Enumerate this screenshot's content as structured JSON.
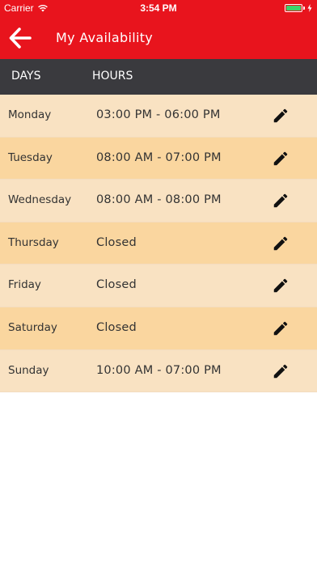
{
  "status_bar": {
    "carrier": "Carrier",
    "time": "3:54 PM"
  },
  "app_bar": {
    "title": "My Availability",
    "back_icon": "arrow-left-icon"
  },
  "table_header": {
    "days": "DAYS",
    "hours": "HOURS"
  },
  "availability": [
    {
      "day": "Monday",
      "hours": "03:00 PM - 06:00 PM"
    },
    {
      "day": "Tuesday",
      "hours": "08:00 AM - 07:00 PM"
    },
    {
      "day": "Wednesday",
      "hours": "08:00 AM - 08:00 PM"
    },
    {
      "day": "Thursday",
      "hours": "Closed"
    },
    {
      "day": "Friday",
      "hours": "Closed"
    },
    {
      "day": "Saturday",
      "hours": "Closed"
    },
    {
      "day": "Sunday",
      "hours": "10:00 AM - 07:00 PM"
    }
  ],
  "colors": {
    "brand_red": "#e8141d",
    "header_dark": "#3a3a3e",
    "row_light": "#f9e2c2",
    "row_dark": "#fad69f",
    "battery_green": "#3cd36a"
  }
}
